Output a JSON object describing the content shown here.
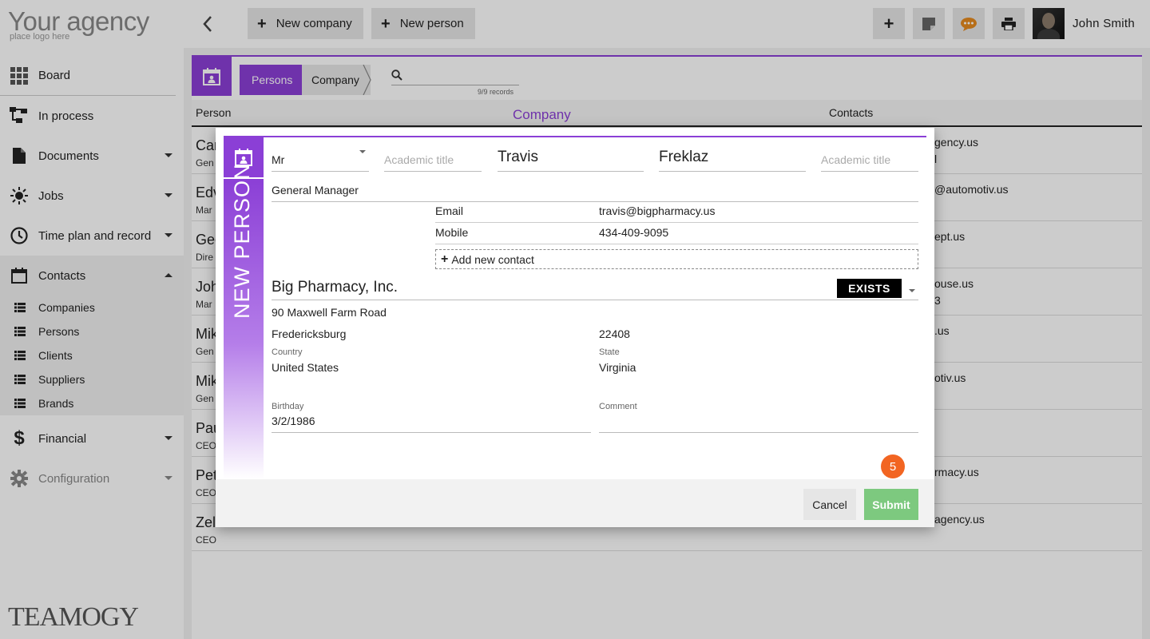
{
  "brand": {
    "logo_main": "Your agency",
    "logo_sub": "place logo here",
    "footer_logo": "TEAMOGY"
  },
  "colors": {
    "accent": "#8b3fd6",
    "submit": "#7dc97f",
    "badge": "#f26522",
    "exists": "#000000"
  },
  "sidebar": {
    "items": [
      {
        "label": "Board",
        "icon": "grid-icon"
      },
      {
        "label": "In process",
        "icon": "flow-icon"
      },
      {
        "label": "Documents",
        "icon": "document-icon"
      },
      {
        "label": "Jobs",
        "icon": "jobs-icon"
      },
      {
        "label": "Time plan and record",
        "icon": "clock-icon"
      },
      {
        "label": "Contacts",
        "icon": "calendar-icon"
      },
      {
        "label": "Financial",
        "icon": "dollar-icon"
      },
      {
        "label": "Configuration",
        "icon": "gear-icon"
      }
    ],
    "contacts_sub": [
      "Companies",
      "Persons",
      "Clients",
      "Suppliers",
      "Brands"
    ]
  },
  "topbar": {
    "new_company": "New company",
    "new_person": "New person",
    "user_name": "John Smith"
  },
  "list": {
    "crumb_persons": "Persons",
    "crumb_company": "Company",
    "records": "9/9 records",
    "headers": {
      "person": "Person",
      "company": "Company",
      "contacts": "Contacts"
    },
    "rows": [
      {
        "name": "Car",
        "role": "Gen",
        "c1": "gency.us",
        "c2": "l"
      },
      {
        "name": "Edv",
        "role": "Mar",
        "c1": "@automotiv.us",
        "c2": ""
      },
      {
        "name": "Geo",
        "role": "Dire",
        "c1": "ept.us",
        "c2": ""
      },
      {
        "name": "Joh",
        "role": "Mar",
        "c1": "ouse.us",
        "c2": "3"
      },
      {
        "name": "Mik",
        "role": "Gen",
        "c1": ".us",
        "c2": ""
      },
      {
        "name": "Mik",
        "role": "Gen",
        "c1": "otiv.us",
        "c2": ""
      },
      {
        "name": "Pau",
        "role": "CEO",
        "c1": "",
        "c2": ""
      },
      {
        "name": "Pet",
        "role": "CEO",
        "c1": "rmacy.us",
        "c2": ""
      },
      {
        "name": "Zel",
        "role": "CEO",
        "c1": "agency.us",
        "c2": ""
      }
    ]
  },
  "modal": {
    "side_title": "NEW PERSON",
    "salutation": "Mr",
    "academic_title_placeholder": "Academic title",
    "first_name": "Travis",
    "last_name": "Freklaz",
    "academic_title_after_placeholder": "Academic title",
    "job_title": "General Manager",
    "contacts": [
      {
        "type": "Email",
        "value": "travis@bigpharmacy.us"
      },
      {
        "type": "Mobile",
        "value": "434-409-9095"
      }
    ],
    "add_contact": "Add new contact",
    "company": "Big Pharmacy, Inc.",
    "company_status": "EXISTS",
    "street": "90  Maxwell Farm Road",
    "city": "Fredericksburg",
    "zip": "22408",
    "country_label": "Country",
    "country": "United States",
    "state_label": "State",
    "state": "Virginia",
    "birthday_label": "Birthday",
    "birthday": "3/2/1986",
    "comment_label": "Comment",
    "comment": "",
    "badge": "5",
    "cancel": "Cancel",
    "submit": "Submit"
  }
}
